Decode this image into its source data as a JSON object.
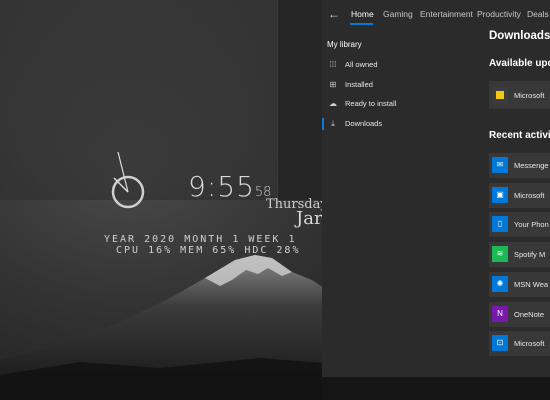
{
  "desktop": {
    "clock": {
      "time": "9:55",
      "seconds": "58"
    },
    "date": {
      "day": "Thursday,",
      "month": "Jar"
    },
    "stats_line1": "YEAR 2020   MONTH 1   WEEK 1",
    "stats_line2": "CPU 16%   MEM 65%   HDC 28%"
  },
  "store": {
    "nav": {
      "back_icon": "arrow-left-icon",
      "tabs": [
        "Home",
        "Gaming",
        "Entertainment",
        "Productivity",
        "Deals"
      ],
      "active_tab": "Home"
    },
    "sidebar": {
      "title": "My library",
      "items": [
        {
          "icon": "grid-icon",
          "label": "All owned"
        },
        {
          "icon": "installed-icon",
          "label": "Installed"
        },
        {
          "icon": "cloud-icon",
          "label": "Ready to install"
        },
        {
          "icon": "download-icon",
          "label": "Downloads"
        }
      ],
      "active_item": "Downloads"
    },
    "content": {
      "title": "Downloads",
      "updates_title": "Available upd",
      "updates": [
        {
          "name": "Microsoft",
          "color": "#f2c811"
        }
      ],
      "recent_title": "Recent activity",
      "recent": [
        {
          "name": "Messenge",
          "color": "#0078d7",
          "icon": "chat-icon"
        },
        {
          "name": "Microsoft",
          "color": "#0078d7",
          "icon": "photos-icon"
        },
        {
          "name": "Your Phon",
          "color": "#0078d7",
          "icon": "phone-icon"
        },
        {
          "name": "Spotify M",
          "color": "#1db954",
          "icon": "spotify-icon"
        },
        {
          "name": "MSN Wea",
          "color": "#0078d7",
          "icon": "sun-icon"
        },
        {
          "name": "OneNote",
          "color": "#7719aa",
          "icon": "onenote-icon"
        },
        {
          "name": "Microsoft",
          "color": "#0078d7",
          "icon": "store-icon"
        }
      ]
    }
  }
}
